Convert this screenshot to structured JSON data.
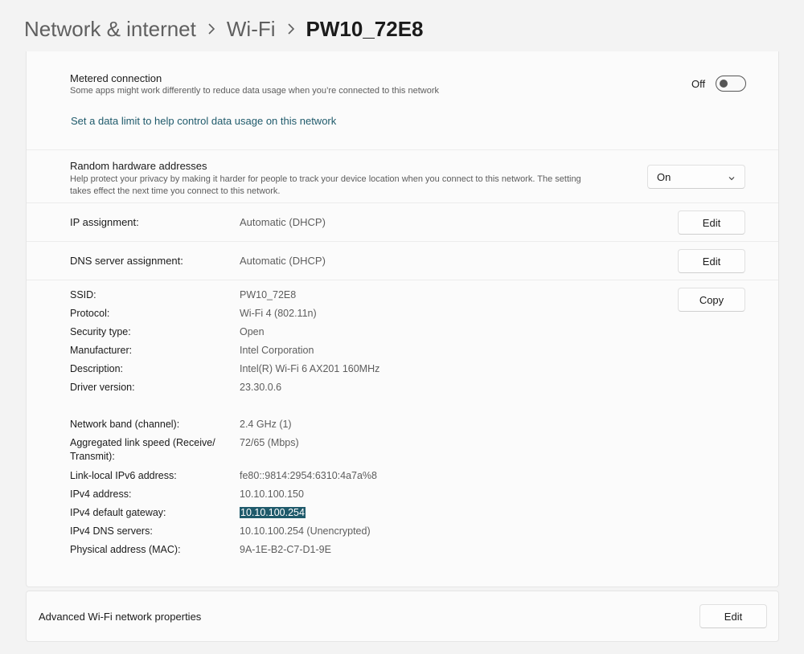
{
  "breadcrumb": {
    "items": [
      "Network & internet",
      "Wi-Fi"
    ],
    "current": "PW10_72E8"
  },
  "metered": {
    "title": "Metered connection",
    "description": "Some apps might work differently to reduce data usage when you’re connected to this network",
    "toggle_label": "Off",
    "toggle_state": "off",
    "link": "Set a data limit to help control data usage on this network"
  },
  "random_hw": {
    "title": "Random hardware addresses",
    "description_line1": "Help protect your privacy by making it harder for people to track your device location when you connect to this network. The setting",
    "description_line2": "takes effect the next time you connect to this network.",
    "selected": "On"
  },
  "ip_assignment": {
    "label": "IP assignment:",
    "value": "Automatic (DHCP)",
    "button": "Edit"
  },
  "dns_assignment": {
    "label": "DNS server assignment:",
    "value": "Automatic (DHCP)",
    "button": "Edit"
  },
  "properties": {
    "copy_button": "Copy",
    "group1": [
      {
        "label": "SSID:",
        "value": "PW10_72E8"
      },
      {
        "label": "Protocol:",
        "value": "Wi-Fi 4 (802.11n)"
      },
      {
        "label": "Security type:",
        "value": "Open"
      },
      {
        "label": "Manufacturer:",
        "value": "Intel Corporation"
      },
      {
        "label": "Description:",
        "value": "Intel(R) Wi-Fi 6 AX201 160MHz"
      },
      {
        "label": "Driver version:",
        "value": "23.30.0.6"
      }
    ],
    "band_label": "Network band (channel):",
    "band_value": "2.4 GHz (1)",
    "speed_label_line1": "Aggregated link speed (Receive/",
    "speed_label_line2": "Transmit):",
    "speed_value": "72/65 (Mbps)",
    "ipv6_label": "Link-local IPv6 address:",
    "ipv6_value": "fe80::9814:2954:6310:4a7a%8",
    "ipv4_label": "IPv4 address:",
    "ipv4_value": "10.10.100.150",
    "gateway_label": "IPv4 default gateway:",
    "gateway_value": "10.10.100.254",
    "dns_label": "IPv4 DNS servers:",
    "dns_value": "10.10.100.254 (Unencrypted)",
    "mac_label": "Physical address (MAC):",
    "mac_value": "9A-1E-B2-C7-D1-9E"
  },
  "advanced": {
    "title": "Advanced Wi-Fi network properties",
    "button": "Edit"
  },
  "colors": {
    "accent": "#1f5a6b",
    "background": "#f3f3f3",
    "card": "#fbfbfb"
  }
}
